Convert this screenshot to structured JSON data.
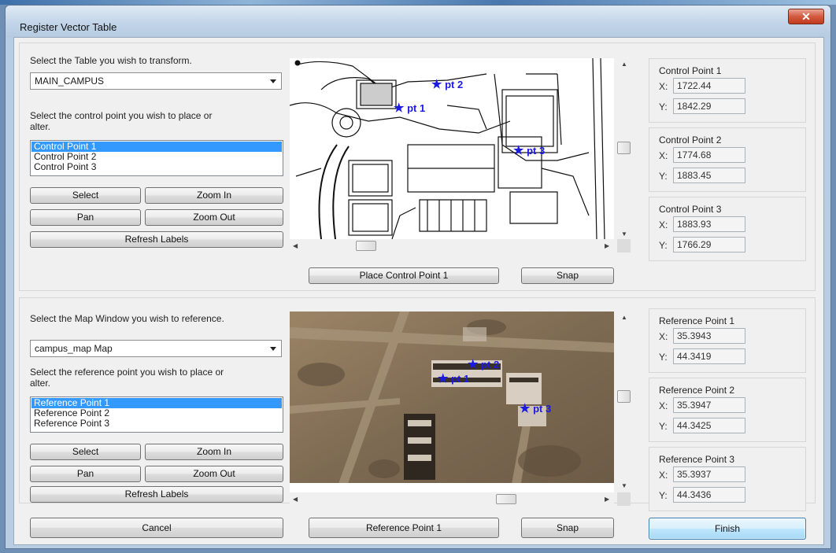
{
  "window": {
    "title": "Register Vector Table",
    "close_glyph": "✕"
  },
  "top": {
    "table_prompt": "Select the Table you wish to transform.",
    "table_value": "MAIN_CAMPUS",
    "point_prompt": "Select the control point you wish to place or alter.",
    "points": [
      "Control Point 1",
      "Control Point 2",
      "Control Point 3"
    ],
    "buttons": {
      "select": "Select",
      "zoom_in": "Zoom In",
      "pan": "Pan",
      "zoom_out": "Zoom Out",
      "refresh": "Refresh Labels",
      "place": "Place Control Point 1",
      "snap": "Snap"
    },
    "map_labels": [
      "pt 2",
      "pt 1",
      "pt 3"
    ],
    "coords": [
      {
        "title": "Control Point 1",
        "x": "1722.44",
        "y": "1842.29"
      },
      {
        "title": "Control Point 2",
        "x": "1774.68",
        "y": "1883.45"
      },
      {
        "title": "Control Point 3",
        "x": "1883.93",
        "y": "1766.29"
      }
    ]
  },
  "bottom": {
    "map_prompt": "Select the Map Window you wish to reference.",
    "map_value": "campus_map Map",
    "point_prompt": "Select the reference point you wish to place or alter.",
    "points": [
      "Reference Point 1",
      "Reference Point 2",
      "Reference Point 3"
    ],
    "buttons": {
      "select": "Select",
      "zoom_in": "Zoom In",
      "pan": "Pan",
      "zoom_out": "Zoom Out",
      "refresh": "Refresh Labels",
      "place": "Reference Point 1",
      "snap": "Snap"
    },
    "map_labels": [
      "pt 2",
      "pt 1",
      "pt 3"
    ],
    "coords": [
      {
        "title": "Reference Point 1",
        "x": "35.3943",
        "y": "44.3419"
      },
      {
        "title": "Reference Point 2",
        "x": "35.3947",
        "y": "44.3425"
      },
      {
        "title": "Reference Point 3",
        "x": "35.3937",
        "y": "44.3436"
      }
    ]
  },
  "footer": {
    "cancel": "Cancel",
    "finish": "Finish"
  },
  "labels": {
    "x": "X:",
    "y": "Y:"
  },
  "colors": {
    "marker": "#1a1ae0",
    "selection": "#3399ff"
  }
}
